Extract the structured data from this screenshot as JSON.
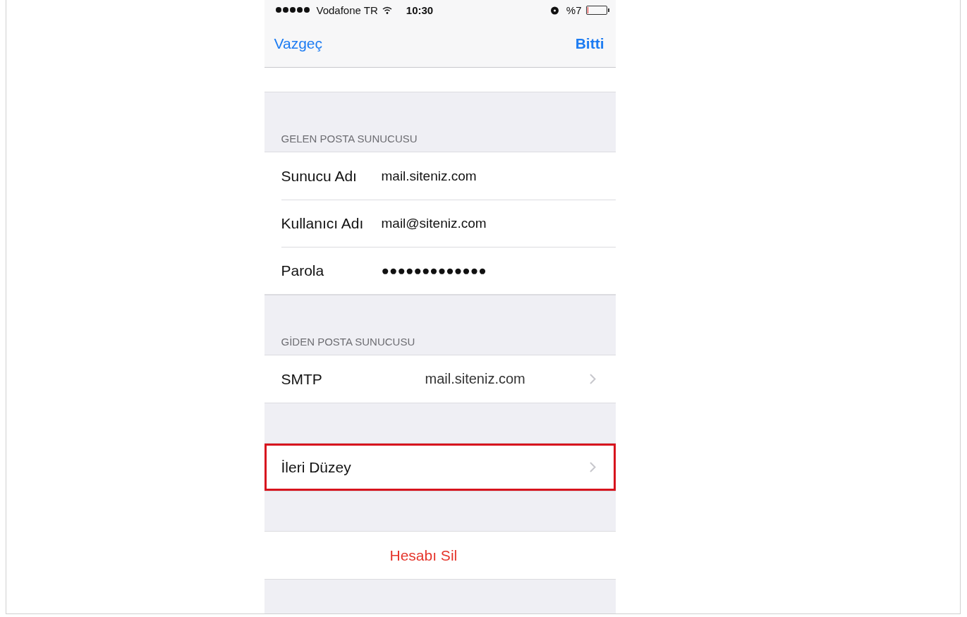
{
  "status_bar": {
    "carrier": "Vodafone TR",
    "time": "10:30",
    "battery_text": "%7",
    "battery": {
      "level": 0.07
    }
  },
  "nav": {
    "left": "Vazgeç",
    "right": "Bitti"
  },
  "sections": [
    {
      "header": "GELEN POSTA SUNUCUSU",
      "rows": [
        {
          "kind": "field",
          "label": "Sunucu Adı",
          "value": "mail.siteniz.com",
          "highlighted": false
        },
        {
          "kind": "field",
          "label": "Kullanıcı Adı",
          "value": "mail@siteniz.com",
          "highlighted": false
        },
        {
          "kind": "field",
          "label": "Parola",
          "value": "●●●●●●●●●●●●●",
          "highlighted": false
        }
      ]
    },
    {
      "header": "GİDEN POSTA SUNUCUSU",
      "rows": [
        {
          "kind": "link",
          "label": "SMTP",
          "value": "mail.siteniz.com",
          "highlighted": false
        }
      ]
    },
    {
      "rows": [
        {
          "kind": "link",
          "label": "İleri Düzey",
          "highlighted": true
        }
      ]
    },
    {
      "rows": [
        {
          "kind": "destructive",
          "label": "Hesabı Sil",
          "highlighted": false
        }
      ]
    }
  ]
}
